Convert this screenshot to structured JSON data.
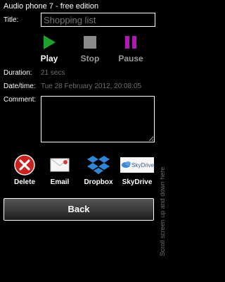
{
  "app": {
    "title": "Audio phone 7 - free edition"
  },
  "form": {
    "title_label": "Title:",
    "title_placeholder": "Shopping list",
    "duration_label": "Duration:",
    "duration_value": "21 secs",
    "datetime_label": "Date/time:",
    "datetime_value": "Tue 28 February 2012, 20:08:05",
    "comment_label": "Comment:"
  },
  "controls": {
    "play": {
      "label": "Play",
      "color": "#1fa22b"
    },
    "stop": {
      "label": "Stop",
      "color": "#8a8a8a"
    },
    "pause": {
      "label": "Pause",
      "color": "#b01ab3"
    }
  },
  "share": [
    {
      "label": "Delete",
      "icon": "delete-icon"
    },
    {
      "label": "Email",
      "icon": "email-icon"
    },
    {
      "label": "Dropbox",
      "icon": "dropbox-icon"
    },
    {
      "label": "SkyDrive",
      "icon": "skydrive-icon",
      "logo_text": "SkyDrive"
    }
  ],
  "back_label": "Back",
  "side_hint": "Scroll screen up and down here"
}
